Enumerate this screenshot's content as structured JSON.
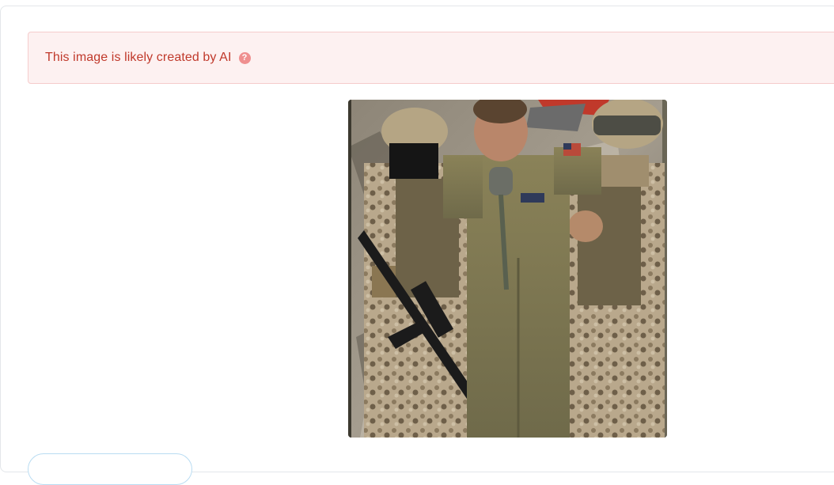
{
  "alert": {
    "message": "This image is likely created by AI",
    "help_icon_glyph": "?",
    "help_icon": "question-circle-icon",
    "color": "#c0392b",
    "background": "#fdf1f1"
  },
  "photo": {
    "subject": "photo-of-soldiers-escorting-pilot"
  }
}
